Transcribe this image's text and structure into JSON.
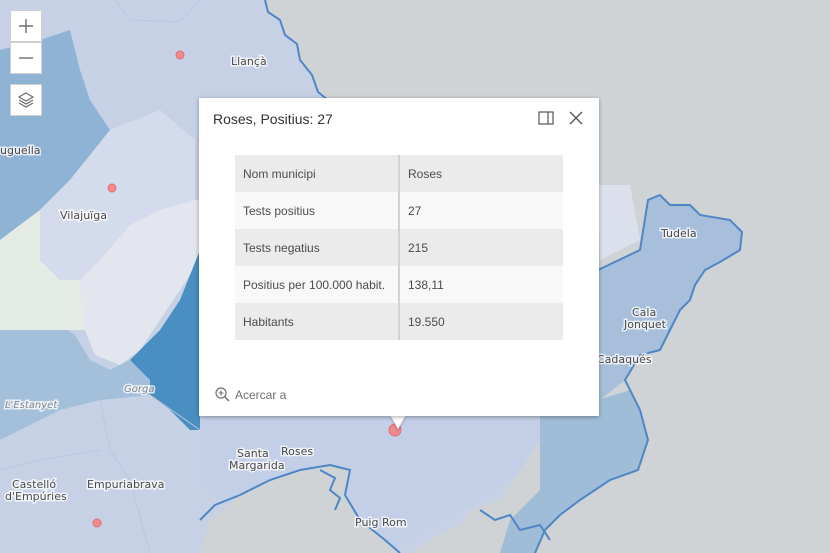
{
  "map": {
    "colors": {
      "sea": "#cfd3d6",
      "land_light": "#c6d1e6",
      "land_very_light": "#e3e6ef",
      "land_mid": "#a0bdd8",
      "land_dark": "#8fb3d4",
      "land_darkest": "#4a8fc1",
      "green_area": "#e4ebe4",
      "coast": "#4f86c6",
      "marker": "#f08a8f"
    },
    "labels": {
      "llanca": "Llançà",
      "uguella": "uguella",
      "vilajuiga": "Vilajuïga",
      "tudela": "Tudela",
      "cala_jonquet_1": "Cala",
      "cala_jonquet_2": "Jonquet",
      "cadaques": "Cadaqués",
      "gorga": "Gorga",
      "estanyet": "L'Estanyet",
      "castello_1": "Castelló",
      "castello_2": "d'Empúries",
      "empuriabrava": "Empuriabrava",
      "santa_margarida_1": "Santa",
      "santa_margarida_2": "Margarida",
      "roses": "Roses",
      "puig_rom": "Puig Rom"
    }
  },
  "controls": {
    "zoom_in_icon": "plus-icon",
    "zoom_out_icon": "minus-icon",
    "layers_icon": "layers-icon"
  },
  "popup": {
    "title": "Roses, Positius: 27",
    "dock_icon": "dock-icon",
    "close_icon": "close-icon",
    "fields": [
      {
        "key": "Nom municipi",
        "value": "Roses"
      },
      {
        "key": "Tests positius",
        "value": "27"
      },
      {
        "key": "Tests negatius",
        "value": "215"
      },
      {
        "key": "Positius per 100.000 habit.",
        "value": "138,11"
      },
      {
        "key": "Habitants",
        "value": "19.550"
      }
    ],
    "zoom_label": "Acercar a",
    "zoom_icon": "zoom-in-icon"
  }
}
